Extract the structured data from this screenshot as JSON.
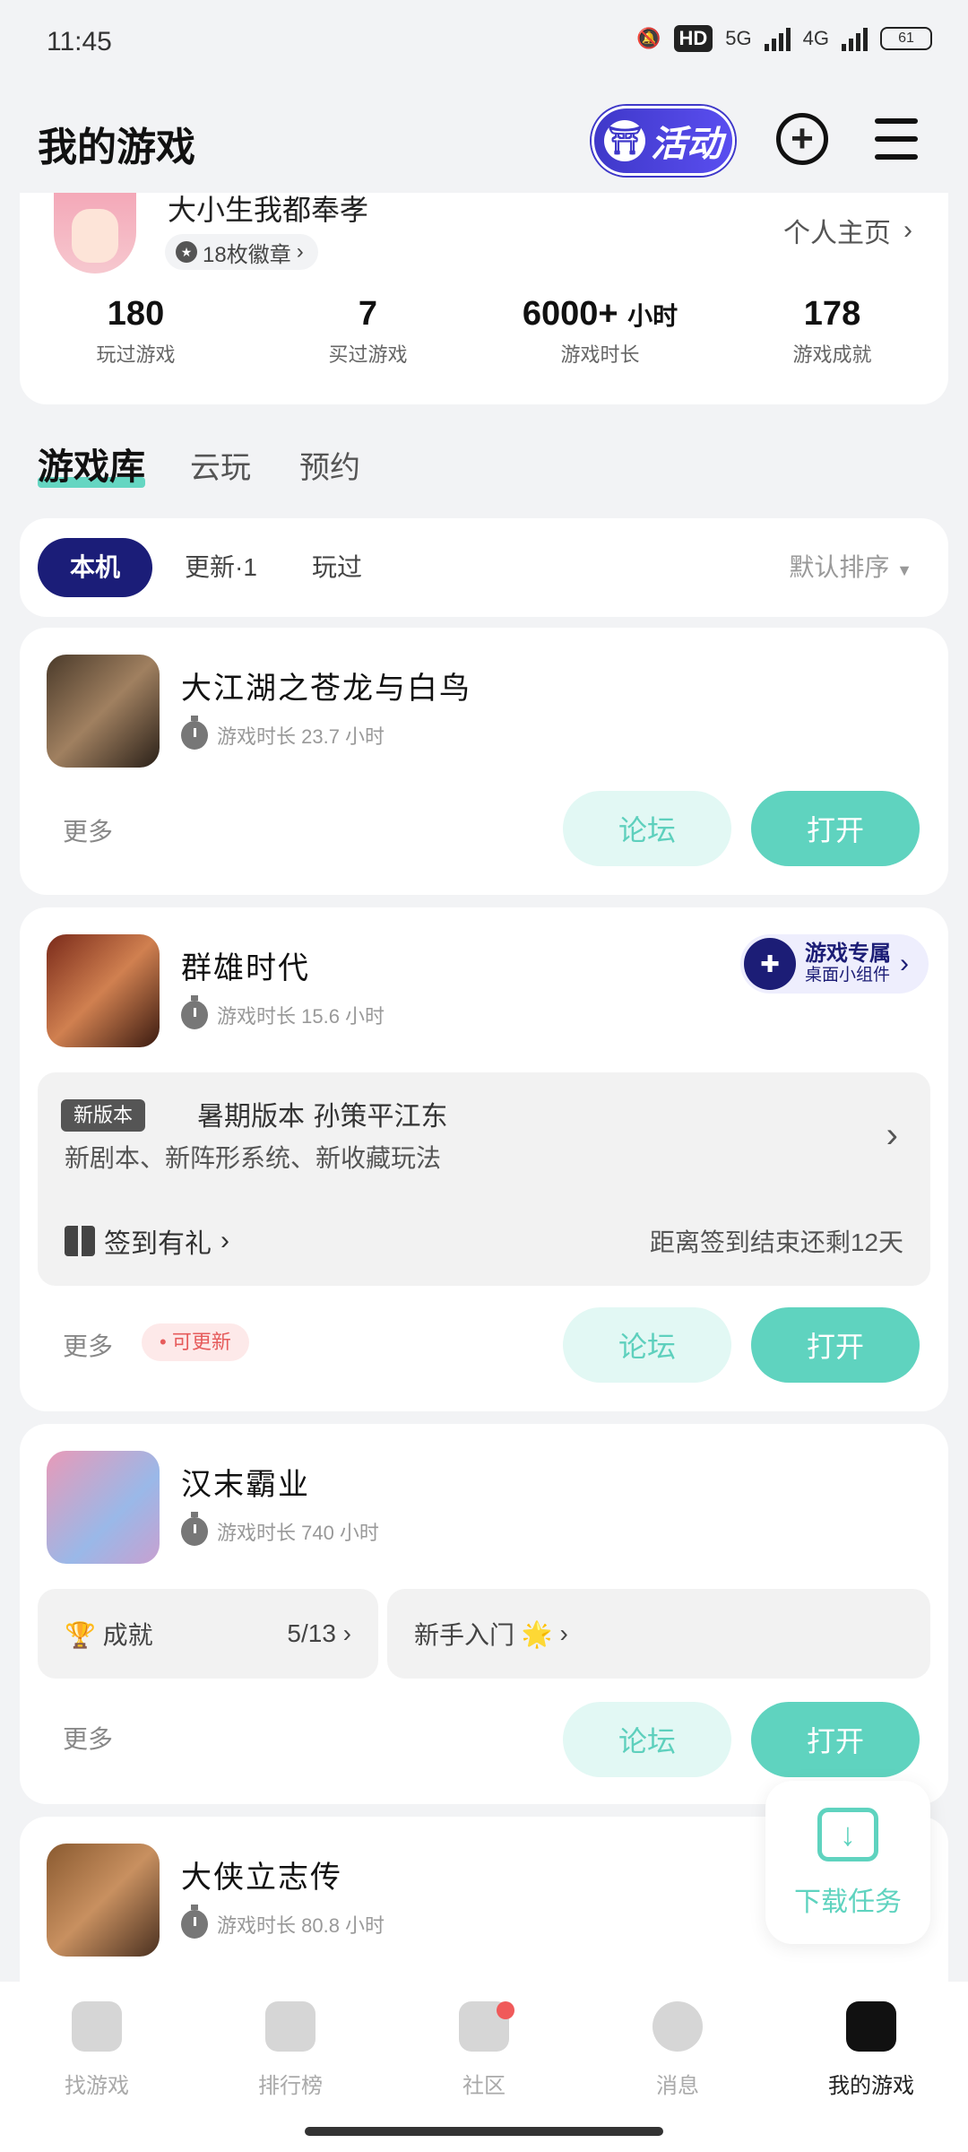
{
  "status": {
    "time": "11:45",
    "network_hd": "HD",
    "net1": "5G",
    "net2": "4G",
    "battery": "61"
  },
  "header": {
    "title": "我的游戏",
    "activity_label": "活动"
  },
  "profile": {
    "username": "大小生我都奉孝",
    "badge": "18枚徽章",
    "homepage": "个人主页",
    "stats": [
      {
        "value": "180",
        "unit": "",
        "label": "玩过游戏"
      },
      {
        "value": "7",
        "unit": "",
        "label": "买过游戏"
      },
      {
        "value": "6000+",
        "unit": "小时",
        "label": "游戏时长"
      },
      {
        "value": "178",
        "unit": "",
        "label": "游戏成就"
      }
    ]
  },
  "lib_tabs": [
    "游戏库",
    "云玩",
    "预约"
  ],
  "filters": {
    "chips": [
      "本机",
      "更新·1",
      "玩过"
    ],
    "sort": "默认排序"
  },
  "games": [
    {
      "name": "大江湖之苍龙与白鸟",
      "time": "游戏时长 23.7 小时",
      "more": "更多",
      "forum": "论坛",
      "open": "打开"
    },
    {
      "name": "群雄时代",
      "time": "游戏时长 15.6 小时",
      "more": "更多",
      "update": "可更新",
      "forum": "论坛",
      "open": "打开",
      "widget": {
        "line1": "游戏专属",
        "line2": "桌面小组件"
      },
      "news": {
        "tag": "新版本",
        "title": "暑期版本 孙策平江东",
        "desc": "新剧本、新阵形系统、新收藏玩法",
        "checkin": "签到有礼",
        "countdown": "距离签到结束还剩12天"
      }
    },
    {
      "name": "汉末霸业",
      "time": "游戏时长 740 小时",
      "more": "更多",
      "forum": "论坛",
      "open": "打开",
      "achievement": {
        "label": "成就",
        "progress": "5/13"
      },
      "guide": "新手入门"
    },
    {
      "name": "大侠立志传",
      "time": "游戏时长 80.8 小时"
    }
  ],
  "download": {
    "label": "下载任务"
  },
  "nav": [
    {
      "label": "找游戏",
      "icon": "find-game-icon"
    },
    {
      "label": "排行榜",
      "icon": "ranking-icon"
    },
    {
      "label": "社区",
      "icon": "community-icon"
    },
    {
      "label": "消息",
      "icon": "message-icon"
    },
    {
      "label": "我的游戏",
      "icon": "my-games-icon"
    }
  ],
  "colors": {
    "accent": "#5fd3bf",
    "navy": "#1b1d78",
    "background": "#f2f3f5"
  }
}
